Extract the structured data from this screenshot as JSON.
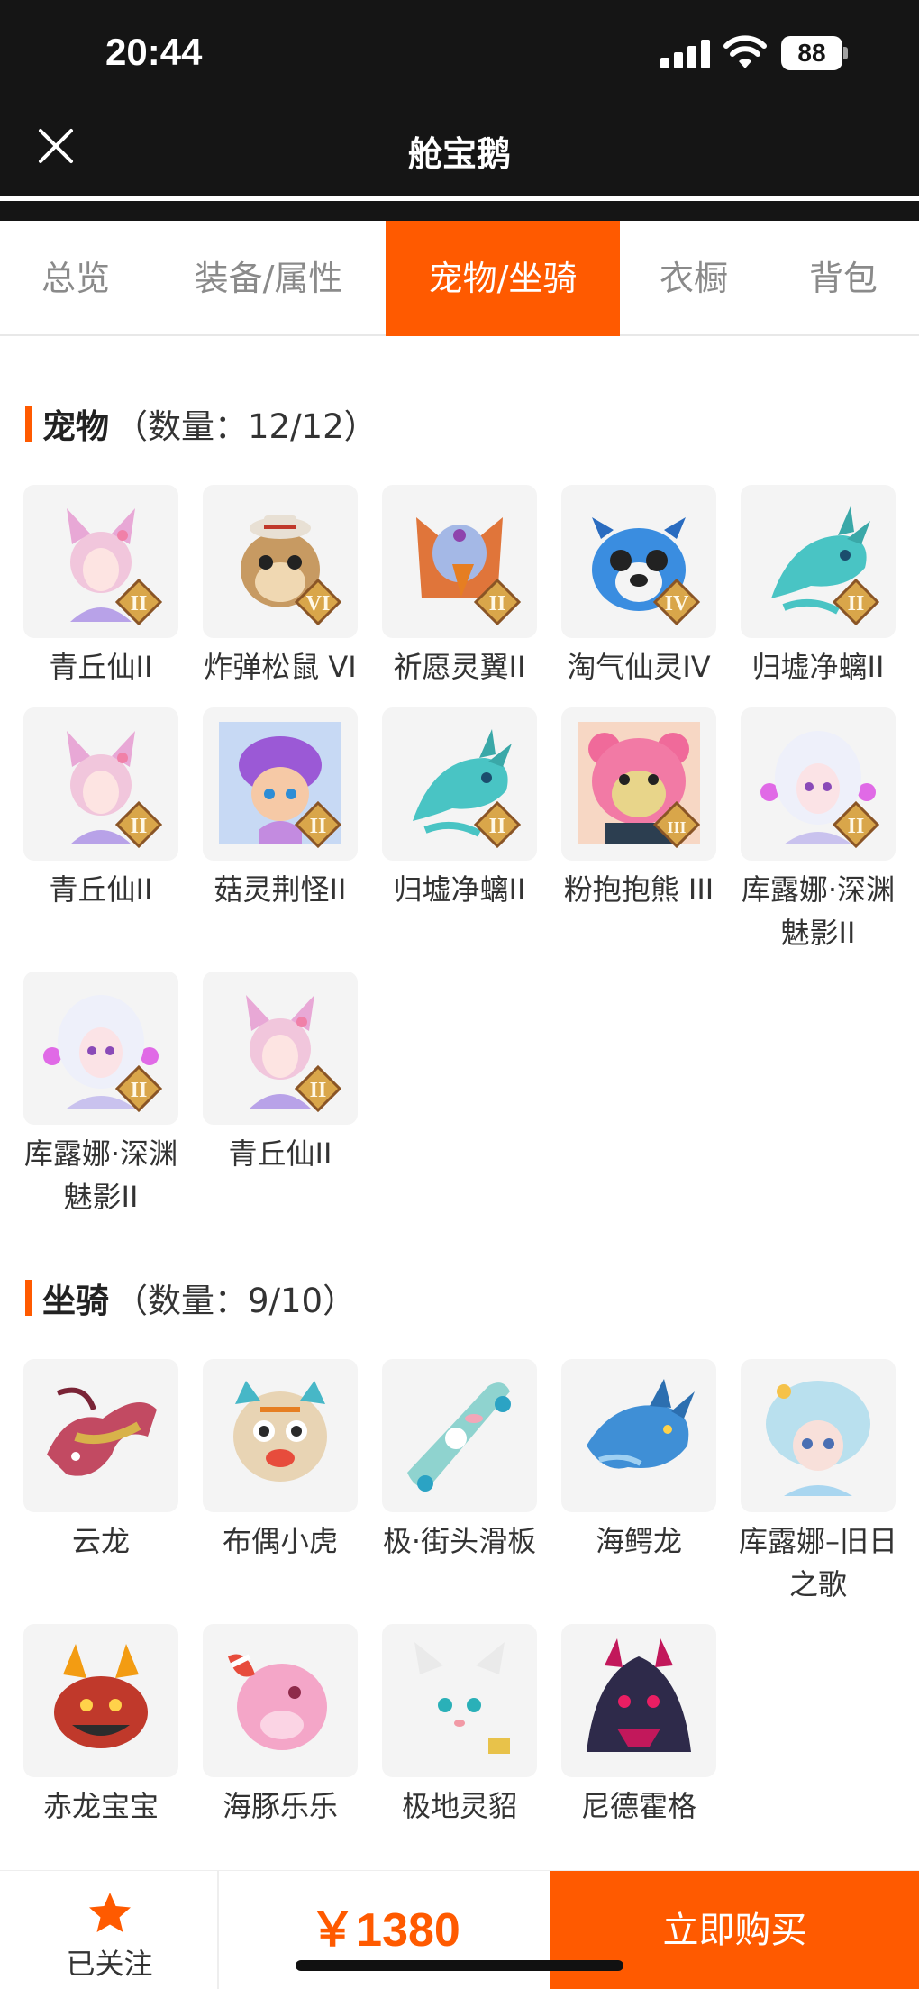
{
  "status_bar": {
    "time": "20:44",
    "battery": "88"
  },
  "header": {
    "title": "舱宝鹅"
  },
  "tabs": [
    {
      "label": "总览",
      "active": false
    },
    {
      "label": "装备/属性",
      "active": false
    },
    {
      "label": "宠物/坐骑",
      "active": true
    },
    {
      "label": "衣橱",
      "active": false
    },
    {
      "label": "背包",
      "active": false
    }
  ],
  "pets": {
    "title": "宠物",
    "count": "（数量：12/12）",
    "items": [
      {
        "name": "青丘仙II",
        "badge": "II",
        "icon": "fox-spirit-icon"
      },
      {
        "name": "炸弹松鼠 VI",
        "badge": "VI",
        "icon": "squirrel-icon"
      },
      {
        "name": "祈愿灵翼II",
        "badge": "II",
        "icon": "griffin-icon"
      },
      {
        "name": "淘气仙灵IV",
        "badge": "IV",
        "icon": "blue-dog-icon"
      },
      {
        "name": "归墟净螭II",
        "badge": "II",
        "icon": "cyan-dragon-icon"
      },
      {
        "name": "青丘仙II",
        "badge": "II",
        "icon": "fox-spirit-icon"
      },
      {
        "name": "菇灵荆怪II",
        "badge": "II",
        "icon": "mushroom-sprite-icon"
      },
      {
        "name": "归墟净螭II",
        "badge": "II",
        "icon": "cyan-dragon-icon"
      },
      {
        "name": "粉抱抱熊 III",
        "badge": "III",
        "icon": "pink-bear-icon"
      },
      {
        "name": "库露娜·深渊魅影II",
        "badge": "II",
        "icon": "white-hair-girl-icon"
      },
      {
        "name": "库露娜·深渊魅影II",
        "badge": "II",
        "icon": "white-hair-girl-icon"
      },
      {
        "name": "青丘仙II",
        "badge": "II",
        "icon": "fox-spirit-icon"
      }
    ]
  },
  "mounts": {
    "title": "坐骑",
    "count": "（数量：9/10）",
    "items": [
      {
        "name": "云龙",
        "icon": "cloud-dragon-icon"
      },
      {
        "name": "布偶小虎",
        "icon": "toy-tiger-icon"
      },
      {
        "name": "极·街头滑板",
        "icon": "skateboard-icon"
      },
      {
        "name": "海鳄龙",
        "icon": "sea-dragon-icon"
      },
      {
        "name": "库露娜–旧日之歌",
        "icon": "curly-girl-icon"
      },
      {
        "name": "赤龙宝宝",
        "icon": "red-dragon-icon"
      },
      {
        "name": "海豚乐乐",
        "icon": "pink-dolphin-icon"
      },
      {
        "name": "极地灵貂",
        "icon": "white-ferret-icon"
      },
      {
        "name": "尼德霍格",
        "icon": "dark-dragon-icon"
      }
    ]
  },
  "bottom": {
    "follow_label": "已关注",
    "price": "￥1380",
    "buy_label": "立即购买"
  },
  "colors": {
    "accent": "#ff5a00",
    "header_bg": "#151515",
    "tile_bg": "#f4f4f4",
    "badge_gold": "#d9a64a",
    "badge_brown": "#8a5526"
  }
}
